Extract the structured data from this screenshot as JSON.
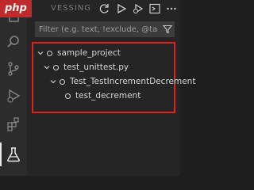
{
  "watermark": {
    "label": "php",
    "faded": "VESSING"
  },
  "filter": {
    "placeholder": "Filter (e.g. text, !exclude, @tag)"
  },
  "tree": [
    {
      "label": "sample_project"
    },
    {
      "label": "test_unittest.py"
    },
    {
      "label": "Test_TestIncrementDecrement"
    },
    {
      "label": "test_decrement"
    }
  ],
  "colors": {
    "highlight": "#e0211b",
    "sidebar": "#252526",
    "activity_bar": "#2c2c2c"
  },
  "icons": [
    "files-icon",
    "search-icon",
    "source-control-icon",
    "run-debug-icon",
    "extensions-icon",
    "testing-icon",
    "refresh-icon",
    "run-all-icon",
    "debug-all-icon",
    "terminal-icon",
    "more-icon",
    "filter-icon"
  ]
}
